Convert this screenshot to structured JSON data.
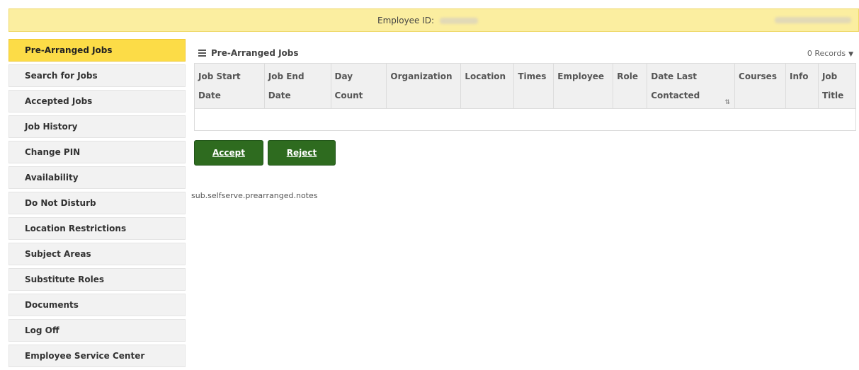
{
  "header": {
    "employee_id_label": "Employee ID:"
  },
  "sidebar": {
    "items": [
      {
        "label": "Pre-Arranged Jobs",
        "active": true
      },
      {
        "label": "Search for Jobs"
      },
      {
        "label": "Accepted Jobs"
      },
      {
        "label": "Job History"
      },
      {
        "label": "Change PIN"
      },
      {
        "label": "Availability"
      },
      {
        "label": "Do Not Disturb"
      },
      {
        "label": "Location Restrictions"
      },
      {
        "label": "Subject Areas"
      },
      {
        "label": "Substitute Roles"
      },
      {
        "label": "Documents"
      },
      {
        "label": "Log Off"
      },
      {
        "label": "Employee Service Center"
      }
    ]
  },
  "panel": {
    "title": "Pre-Arranged Jobs",
    "records_label": "0 Records",
    "columns": [
      {
        "line1": "Job Start",
        "line2": "Date"
      },
      {
        "line1": "Job End",
        "line2": "Date"
      },
      {
        "line1": "Day",
        "line2": "Count"
      },
      {
        "line1": "Organization",
        "line2": ""
      },
      {
        "line1": "Location",
        "line2": ""
      },
      {
        "line1": "Times",
        "line2": ""
      },
      {
        "line1": "Employee",
        "line2": ""
      },
      {
        "line1": "Role",
        "line2": ""
      },
      {
        "line1": "Date Last",
        "line2": "Contacted"
      },
      {
        "line1": "Courses",
        "line2": ""
      },
      {
        "line1": "Info",
        "line2": ""
      },
      {
        "line1": "Job",
        "line2": "Title"
      }
    ],
    "rows": []
  },
  "actions": {
    "accept_label": "Accept",
    "reject_label": "Reject"
  },
  "notes_text": "sub.selfserve.prearranged.notes",
  "icons": {
    "menu": "hamburger-menu-icon",
    "records_dropdown": "caret-down-icon",
    "sort": "sort-icon"
  }
}
